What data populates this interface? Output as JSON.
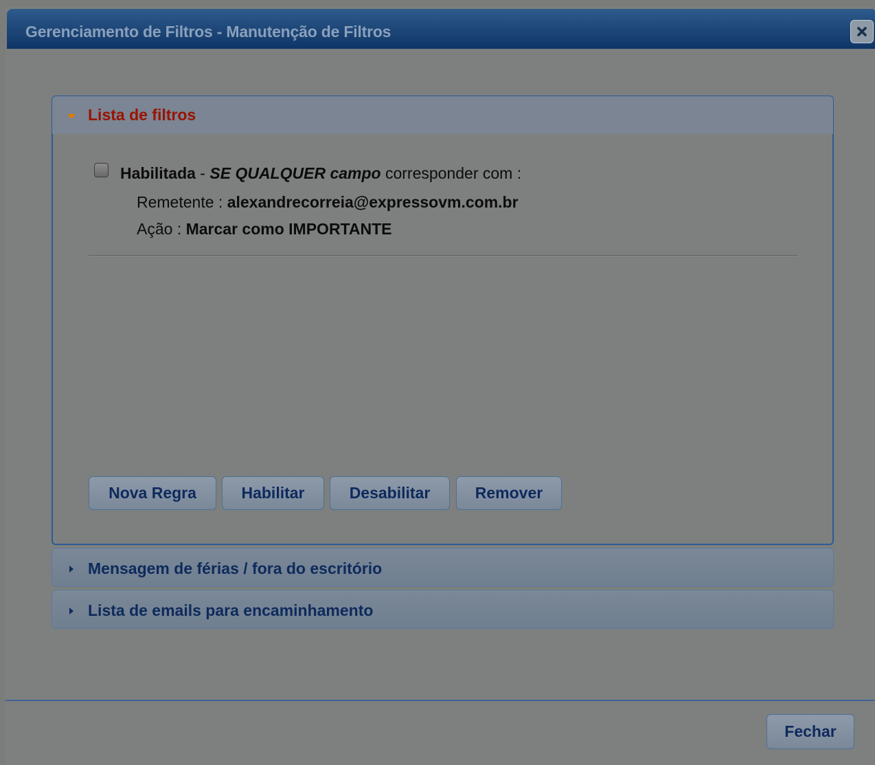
{
  "dialog": {
    "title": "Gerenciamento de Filtros - Manutenção de Filtros",
    "close_icon": "close-icon"
  },
  "filters_panel": {
    "label": "Lista de filtros",
    "expanded": true,
    "rules": [
      {
        "status": "Habilitada",
        "dash": " - ",
        "condition": "SE QUALQUER campo",
        "match_text": " corresponder com :",
        "sender_label": "Remetente : ",
        "sender_value": "alexandrecorreia@expressovm.com.br",
        "action_label": "Ação : ",
        "action_value": "Marcar como IMPORTANTE",
        "checked": false
      }
    ],
    "buttons": {
      "new_rule": "Nova Regra",
      "enable": "Habilitar",
      "disable": "Desabilitar",
      "remove": "Remover"
    }
  },
  "vacation_panel": {
    "label": "Mensagem de férias / fora do escritório",
    "expanded": false
  },
  "forward_panel": {
    "label": "Lista de emails para encaminhamento",
    "expanded": false
  },
  "footer": {
    "close_label": "Fechar"
  },
  "colors": {
    "titlebar": "#0f3566",
    "active_header_text": "#9a1300",
    "header_text": "#0e2a5c",
    "expanded_arrow": "#e07b00"
  }
}
